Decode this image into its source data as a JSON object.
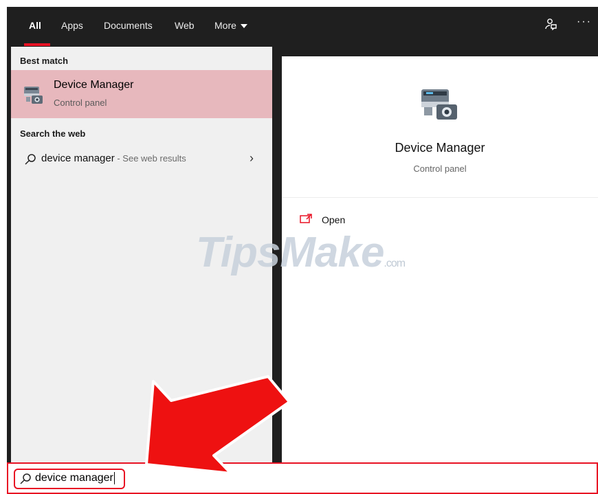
{
  "tabs": [
    {
      "label": "All",
      "active": true
    },
    {
      "label": "Apps"
    },
    {
      "label": "Documents"
    },
    {
      "label": "Web"
    },
    {
      "label": "More"
    }
  ],
  "top_icons": [
    "feedback-icon",
    "more-options-icon"
  ],
  "left_panel": {
    "best_match_label": "Best match",
    "best_match": {
      "title": "Device Manager",
      "subtitle": "Control panel",
      "icon": "device-manager-icon"
    },
    "search_web_label": "Search the web",
    "web_result": {
      "query": "device manager",
      "suffix": " - See web results"
    }
  },
  "right_panel": {
    "title": "Device Manager",
    "subtitle": "Control panel",
    "actions": [
      {
        "label": "Open",
        "icon": "open-icon"
      }
    ]
  },
  "search": {
    "value": "device manager",
    "icon": "search-icon"
  },
  "watermark": {
    "text": "TipsMake",
    "suffix": ".com"
  },
  "colors": {
    "accent": "#e81123",
    "taskbar": "#1f1f1f",
    "selected": "#e7b8bd"
  }
}
